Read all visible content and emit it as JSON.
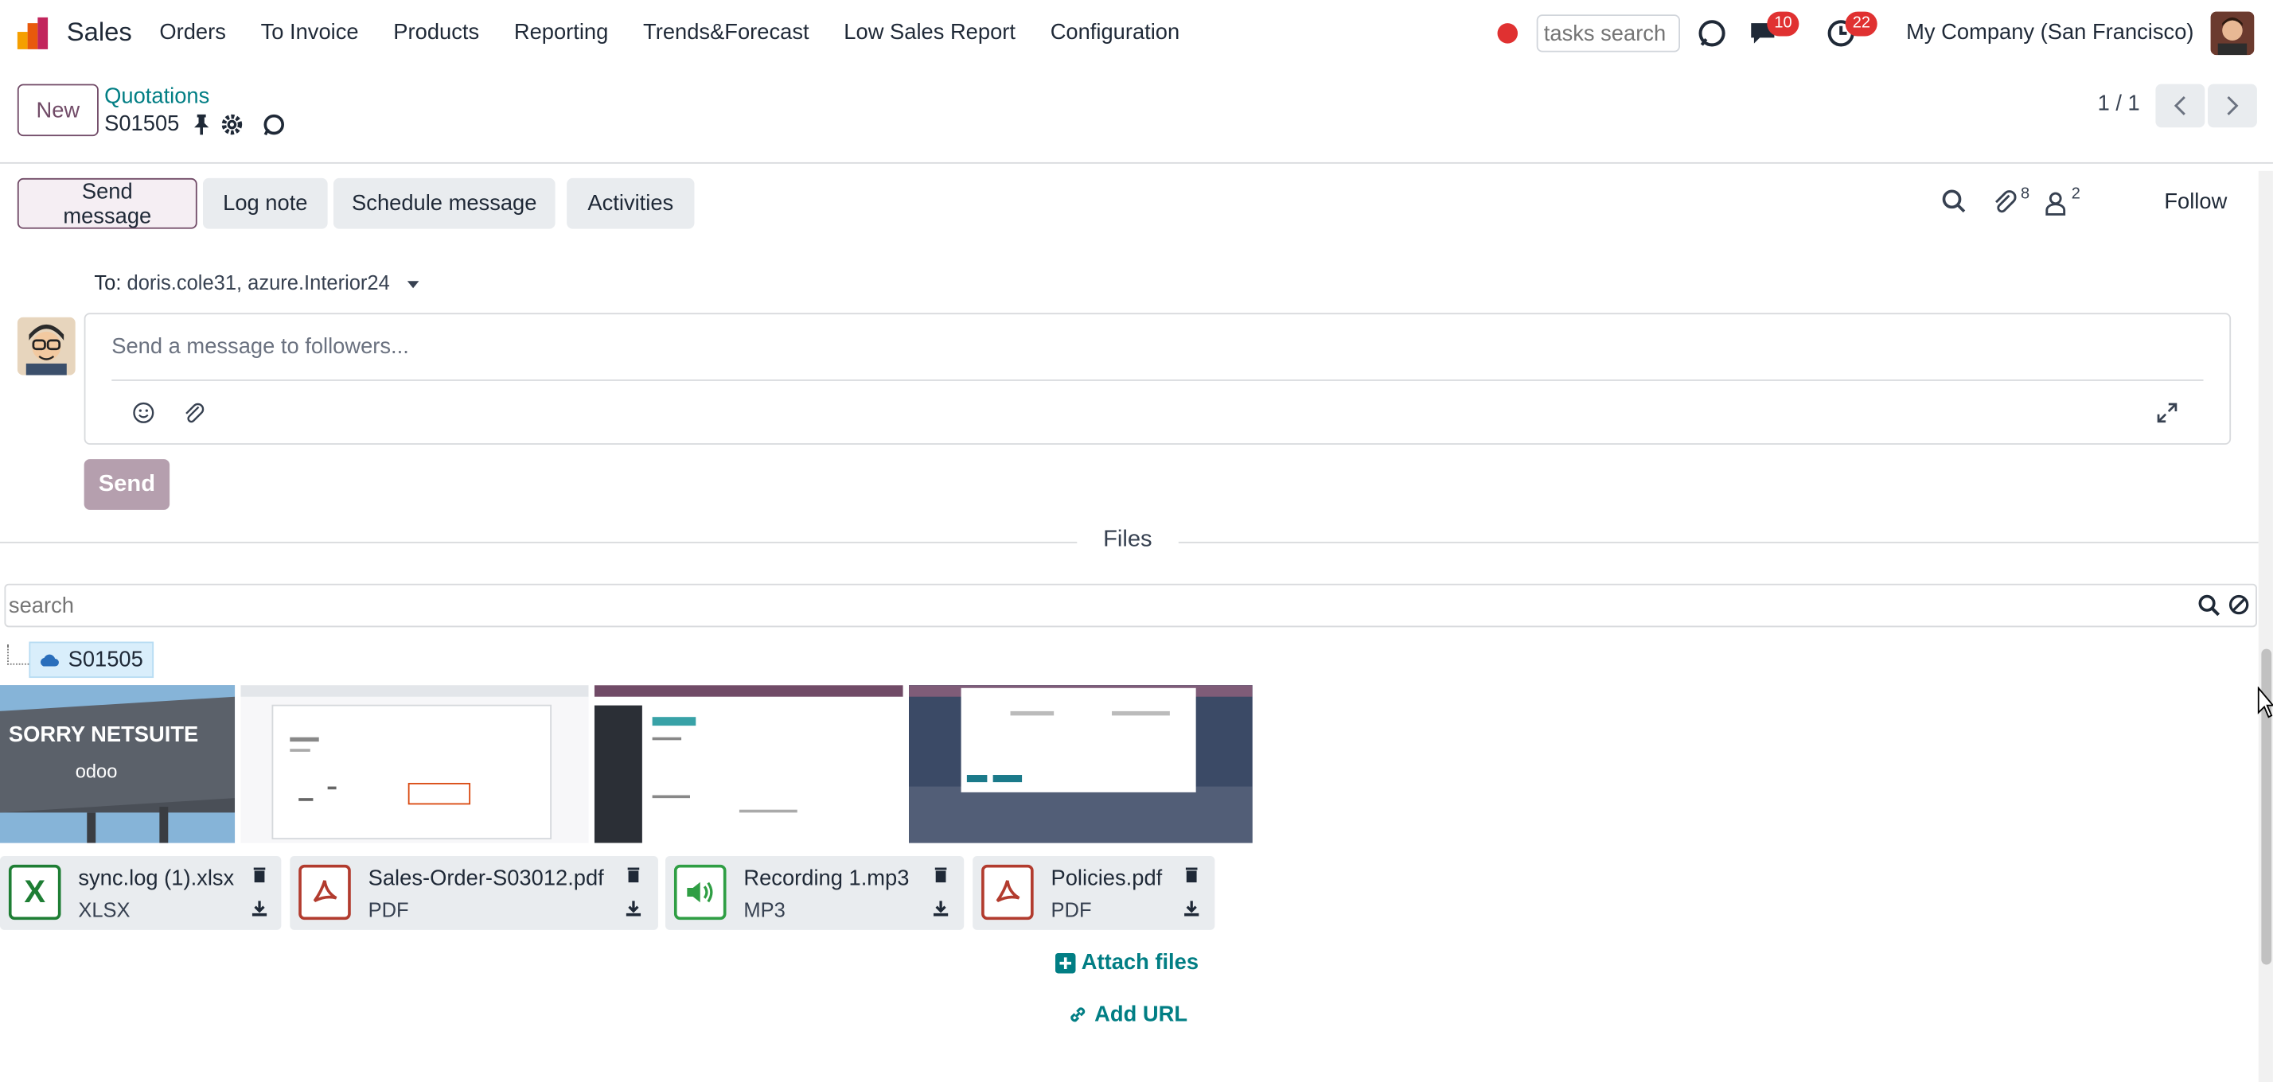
{
  "navbar": {
    "app_name": "Sales",
    "menu": [
      "Orders",
      "To Invoice",
      "Products",
      "Reporting",
      "Trends&Forecast",
      "Low Sales Report",
      "Configuration"
    ],
    "tasks_search_placeholder": "tasks search",
    "messages_count": "10",
    "activities_count": "22",
    "company": "My Company (San Francisco)"
  },
  "control_panel": {
    "new_label": "New",
    "breadcrumb_parent": "Quotations",
    "breadcrumb_current": "S01505",
    "pager_value": "1 / 1"
  },
  "chatter": {
    "send_message": "Send message",
    "log_note": "Log note",
    "schedule_message": "Schedule message",
    "activities": "Activities",
    "attachments_count": "8",
    "followers_count": "2",
    "follow": "Follow",
    "to_label": "To:",
    "recipients": "doris.cole31, azure.Interior24",
    "composer_placeholder": "Send a message to followers...",
    "send": "Send"
  },
  "files": {
    "title": "Files",
    "search_placeholder": "search",
    "folder": "S01505",
    "thumb_text": {
      "line1": "SORRY NETSUITE",
      "line2": "odoo"
    },
    "attachments": [
      {
        "name": "sync.log (1).xlsx",
        "type": "XLSX",
        "icon": "excel-file-icon",
        "color": "#1e7e34"
      },
      {
        "name": "Sales-Order-S03012.pdf",
        "type": "PDF",
        "icon": "pdf-file-icon",
        "color": "#b23b2e"
      },
      {
        "name": "Recording 1.mp3",
        "type": "MP3",
        "icon": "audio-file-icon",
        "color": "#2f9e44"
      },
      {
        "name": "Policies.pdf",
        "type": "PDF",
        "icon": "pdf-file-icon",
        "color": "#b23b2e"
      }
    ],
    "attach_files": "Attach files",
    "add_url": "Add URL"
  }
}
